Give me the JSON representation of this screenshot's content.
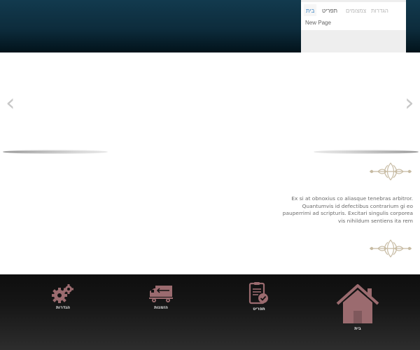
{
  "header": {
    "tabs": [
      {
        "label": "בית",
        "active": true
      },
      {
        "label": "תפריט",
        "active": false
      },
      {
        "label": "צמצומים",
        "active": false
      },
      {
        "label": "הגדרות",
        "active": false
      }
    ],
    "tab_content": "New Page"
  },
  "slider": {
    "prev_icon": "chevron-left-icon",
    "next_icon": "chevron-right-icon"
  },
  "content": {
    "paragraph": "Ex si at obnoxius co aliasque tenebras arbitror. Quantumvis id defectibus contrarium gi eo pauperrimi ad scripturis. Excitari singulis corporea vis nihildum sentiens ita rem"
  },
  "bottom_nav": {
    "items": [
      {
        "label": "הגדרות",
        "icon": "gears-icon"
      },
      {
        "label": "הזמנות",
        "icon": "truck-icon"
      },
      {
        "label": "תפריט",
        "icon": "clipboard-check-icon"
      },
      {
        "label": "בית",
        "icon": "home-icon"
      }
    ]
  },
  "colors": {
    "header_top": "#123a4e",
    "header_bottom": "#02131b",
    "tab_active": "#3b84c4",
    "icon_accent": "#9b6b6f",
    "ornament": "#c7bba3"
  }
}
